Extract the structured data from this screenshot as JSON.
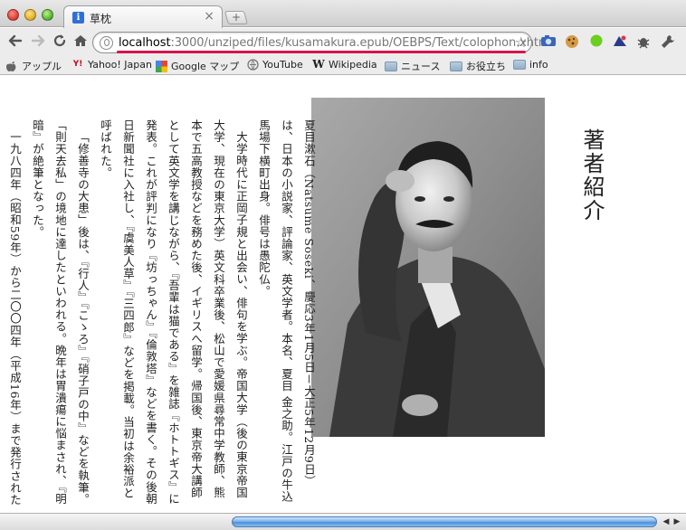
{
  "tab": {
    "title": "草枕",
    "favicon": "i"
  },
  "toolbar": {
    "url_host": "localhost",
    "url_rest": ":3000/unziped/files/kusamakura.epub/OEBPS/Text/colophon.xhtml"
  },
  "bookmarks": [
    {
      "label": "アップル",
      "icon": "apple-icon"
    },
    {
      "label": "Yahoo! Japan",
      "icon": "yahoo-icon"
    },
    {
      "label": "Google マップ",
      "icon": "google-maps-icon"
    },
    {
      "label": "YouTube",
      "icon": "youtube-icon"
    },
    {
      "label": "Wikipedia",
      "icon": "wikipedia-icon"
    },
    {
      "label": "ニュース",
      "icon": "folder-icon"
    },
    {
      "label": "お役立ち",
      "icon": "folder-icon"
    },
    {
      "label": "info",
      "icon": "folder-icon"
    }
  ],
  "page": {
    "heading": "著者紹介",
    "paragraphs": [
      "夏目漱石（Natsume Soseki、慶応3年1月5日－大正5年12月9日）は、日本の小説家、評論家、英文学者。本名、夏目 金之助。江戸の牛込馬場下横町出身。俳号は愚陀仏。",
      "大学時代に正岡子規と出会い、俳句を学ぶ。帝国大学（後の東京帝国大学、現在の東京大学）英文科卒業後、松山で愛媛県尋常中学教師、熊本で五高教授などを務めた後、イギリスへ留学。帰国後、東京帝大講師として英文学を講じながら、『吾輩は猫である』を雑誌『ホトトギス』に発表。これが評判になり『坊っちゃん』『倫敦塔』などを書く。その後朝日新聞社に入社し、『虞美人草』『三四郎』などを掲載。当初は余裕派と呼ばれた。",
      "「修善寺の大患」後は、『行人』『こゝろ』『硝子戸の中』などを執筆。「則天去私」の境地に達したといわれる。晩年は胃潰瘍に悩まされ、『明暗』が絶筆となった。",
      "一九八四年（昭和59年）から二〇〇四年（平成16年）まで発行された日本銀行券Ｄ千円券に肖像が採用された。"
    ]
  },
  "colors": {
    "accent_underline": "#d7154b",
    "scroll_thumb": "#4b8fd9"
  }
}
